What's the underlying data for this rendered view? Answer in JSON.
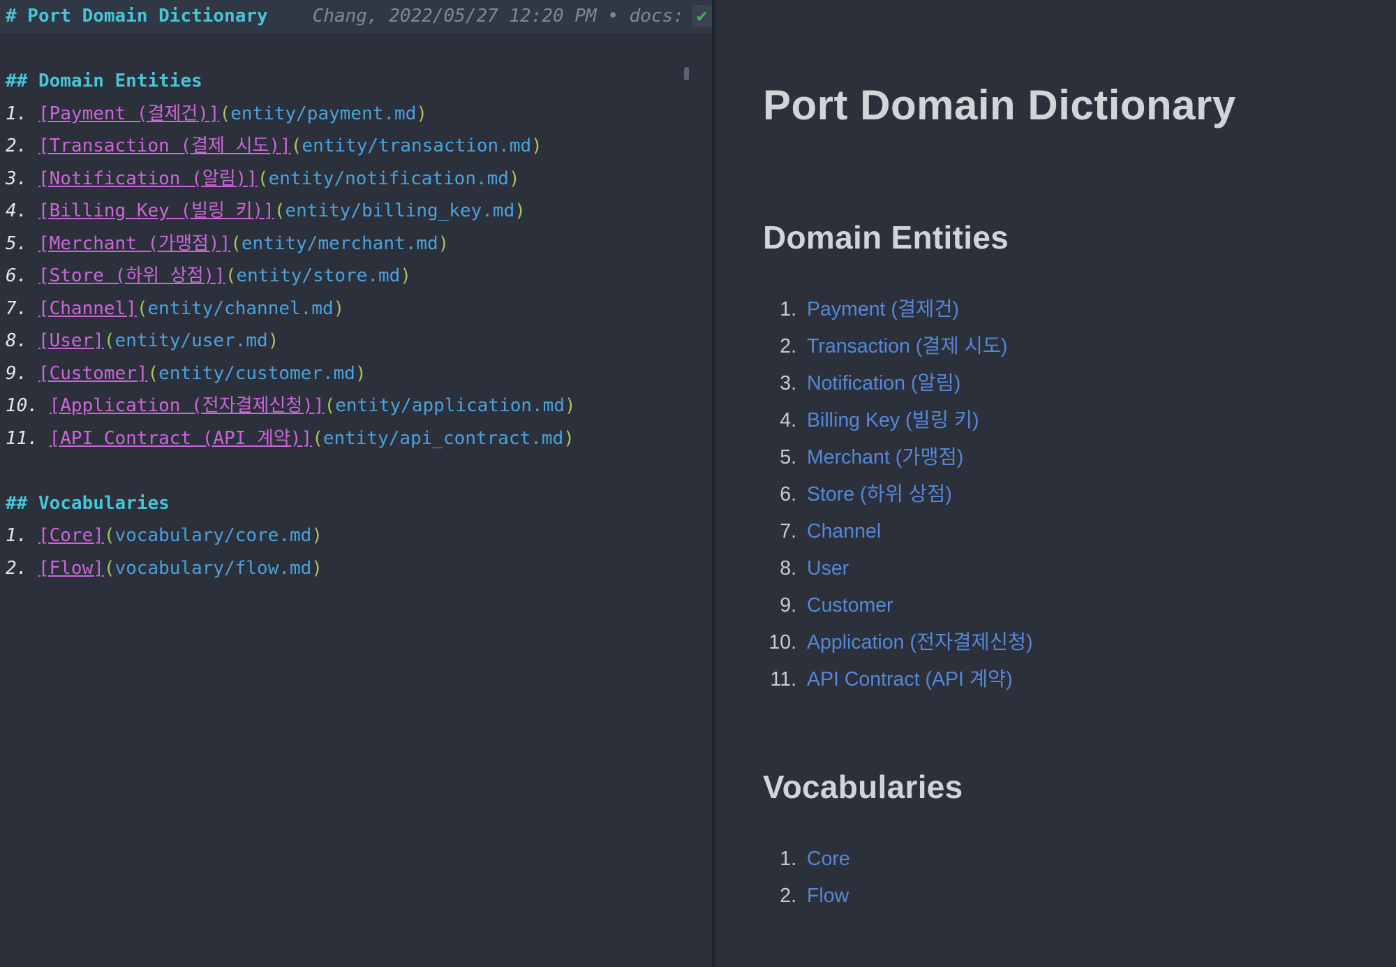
{
  "colors": {
    "background": "#2b303b",
    "heading_teal": "#47c4d6",
    "link_magenta": "#cc66d9",
    "paren_green": "#a3c95c",
    "url_blue": "#4aa2dc",
    "blame_gray": "#808896",
    "check_green": "#3fb14e",
    "preview_heading": "#d2d4d8",
    "preview_link": "#5687d8",
    "preview_number": "#c9cdd3"
  },
  "editor": {
    "syntax": {
      "open": "(",
      "close": ")"
    },
    "title_line": {
      "heading": "# Port Domain Dictionary",
      "blame_text": "Chang, 2022/05/27 12:20 PM • docs:",
      "blame_check": "✔",
      "blame_tail": "("
    },
    "sections": [
      {
        "heading": "## Domain Entities",
        "items": [
          {
            "num": "1.",
            "link": "[Payment (결제건)]",
            "path": "entity/payment.md"
          },
          {
            "num": "2.",
            "link": "[Transaction (결제 시도)]",
            "path": "entity/transaction.md"
          },
          {
            "num": "3.",
            "link": "[Notification (알림)]",
            "path": "entity/notification.md"
          },
          {
            "num": "4.",
            "link": "[Billing Key (빌링 키)]",
            "path": "entity/billing_key.md"
          },
          {
            "num": "5.",
            "link": "[Merchant (가맹점)]",
            "path": "entity/merchant.md"
          },
          {
            "num": "6.",
            "link": "[Store (하위 상점)]",
            "path": "entity/store.md"
          },
          {
            "num": "7.",
            "link": "[Channel]",
            "path": "entity/channel.md"
          },
          {
            "num": "8.",
            "link": "[User]",
            "path": "entity/user.md"
          },
          {
            "num": "9.",
            "link": "[Customer]",
            "path": "entity/customer.md"
          },
          {
            "num": "10.",
            "link": "[Application (전자결제신청)]",
            "path": "entity/application.md"
          },
          {
            "num": "11.",
            "link": "[API Contract (API 계약)]",
            "path": "entity/api_contract.md"
          }
        ]
      },
      {
        "heading": "## Vocabularies",
        "items": [
          {
            "num": "1.",
            "link": "[Core]",
            "path": "vocabulary/core.md"
          },
          {
            "num": "2.",
            "link": "[Flow]",
            "path": "vocabulary/flow.md"
          }
        ]
      }
    ]
  },
  "preview": {
    "title": "Port Domain Dictionary",
    "sections": [
      {
        "heading": "Domain Entities",
        "items": [
          {
            "num": "1.",
            "label": "Payment (결제건)"
          },
          {
            "num": "2.",
            "label": "Transaction (결제 시도)"
          },
          {
            "num": "3.",
            "label": "Notification (알림)"
          },
          {
            "num": "4.",
            "label": "Billing Key (빌링 키)"
          },
          {
            "num": "5.",
            "label": "Merchant (가맹점)"
          },
          {
            "num": "6.",
            "label": "Store (하위 상점)"
          },
          {
            "num": "7.",
            "label": "Channel"
          },
          {
            "num": "8.",
            "label": "User"
          },
          {
            "num": "9.",
            "label": "Customer"
          },
          {
            "num": "10.",
            "label": "Application (전자결제신청)"
          },
          {
            "num": "11.",
            "label": "API Contract (API 계약)"
          }
        ]
      },
      {
        "heading": "Vocabularies",
        "items": [
          {
            "num": "1.",
            "label": "Core"
          },
          {
            "num": "2.",
            "label": "Flow"
          }
        ]
      }
    ]
  }
}
